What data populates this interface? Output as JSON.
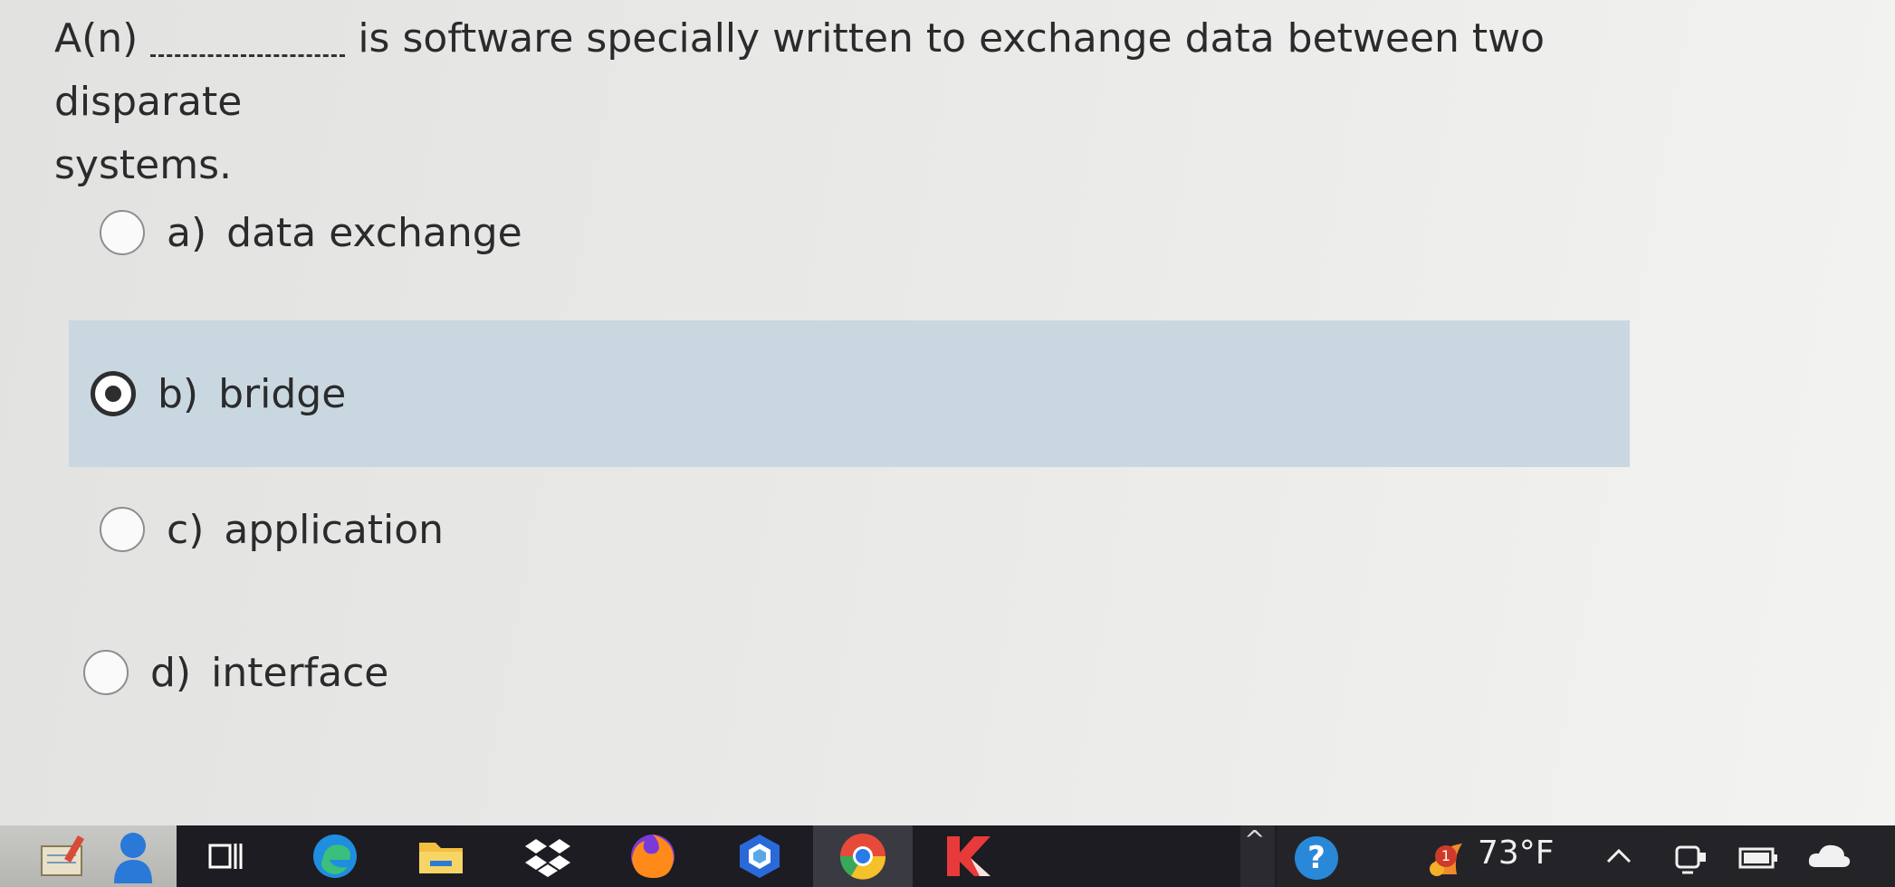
{
  "question": {
    "prefix": "A(n)",
    "suffix": "is software specially written to exchange data between two disparate",
    "continuation": "systems."
  },
  "options": [
    {
      "letter": "a)",
      "text": "data exchange",
      "selected": false
    },
    {
      "letter": "b)",
      "text": "bridge",
      "selected": true
    },
    {
      "letter": "c)",
      "text": "application",
      "selected": false
    },
    {
      "letter": "d)",
      "text": "interface",
      "selected": false
    }
  ],
  "taskbar": {
    "apps": [
      "notepad-icon",
      "person-icon",
      "task-view-icon",
      "edge-icon",
      "file-explorer-icon",
      "dropbox-icon",
      "firefox-icon",
      "copilot-icon",
      "chrome-icon",
      "kaspersky-icon"
    ],
    "tray": {
      "weather_badge": "1",
      "temperature": "73°F",
      "chevron": "^"
    }
  },
  "colors": {
    "selected_bg": "#c9d8e0",
    "taskbar_bg": "#1c1c22"
  }
}
